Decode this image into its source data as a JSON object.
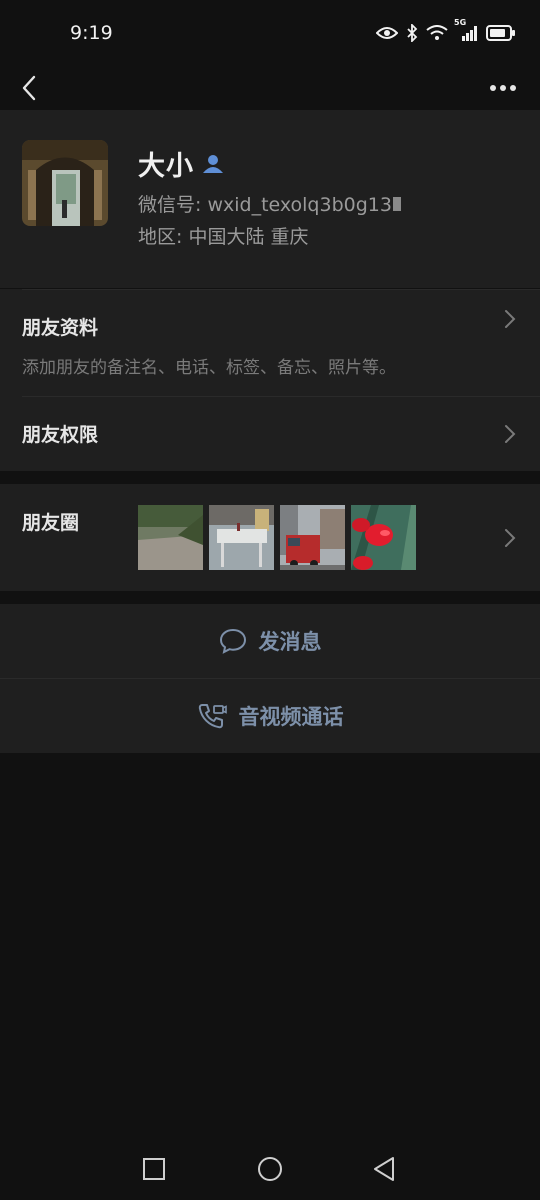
{
  "status": {
    "time": "9:19",
    "network": "5G"
  },
  "profile": {
    "name": "大小",
    "wechat_id": "微信号:  wxid_texolq3b0g13",
    "region": "地区:  中国大陆  重庆"
  },
  "rows": {
    "friend_info_title": "朋友资料",
    "friend_info_subtitle": "添加朋友的备注名、电话、标签、备忘、照片等。",
    "friend_permissions_title": "朋友权限",
    "moments_title": "朋友圈"
  },
  "actions": {
    "send_message": "发消息",
    "video_call": "音视频通话"
  },
  "icons": {
    "back": "back-arrow-icon",
    "more": "more-dots-icon",
    "contact_badge": "person-badge-icon",
    "chat": "chat-bubble-icon",
    "call": "video-call-icon"
  },
  "colors": {
    "background": "#111111",
    "card": "#1f1f1f",
    "accent_link": "#7d90a9",
    "badge_blue": "#5f8fd6"
  }
}
